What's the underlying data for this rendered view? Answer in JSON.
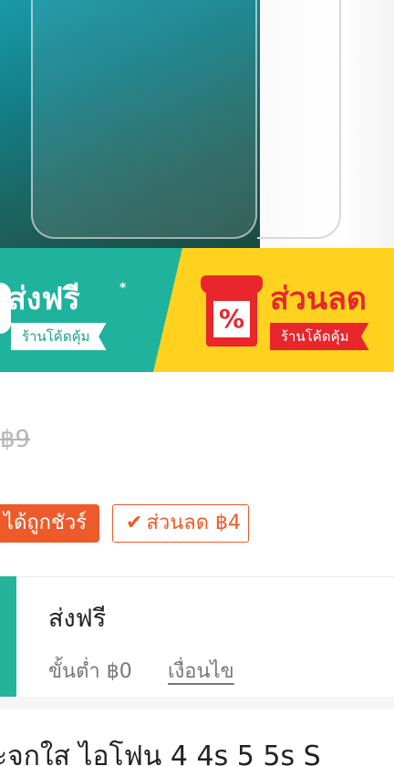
{
  "banner": {
    "free_shipping_title": "ส่งฟรี",
    "free_shipping_star": "*",
    "free_shipping_sub": "ร้านโค้ดคุ้ม",
    "discount_icon": "%",
    "discount_title": "ส่วนลด",
    "discount_sub": "ร้านโค้ดคุ้ม"
  },
  "price": {
    "original": "฿9"
  },
  "badges": {
    "guarantee": "ได้ถูกชัวร์",
    "voucher_check": "✔",
    "voucher": "ส่วนลด ฿4"
  },
  "shipping": {
    "title": "ส่งฟรี",
    "minimum": "ขั้นต่ำ ฿0",
    "conditions": "เงื่อนไข"
  },
  "product": {
    "title": "ะจกใส ไอโฟน 4 4s 5 5s S"
  }
}
